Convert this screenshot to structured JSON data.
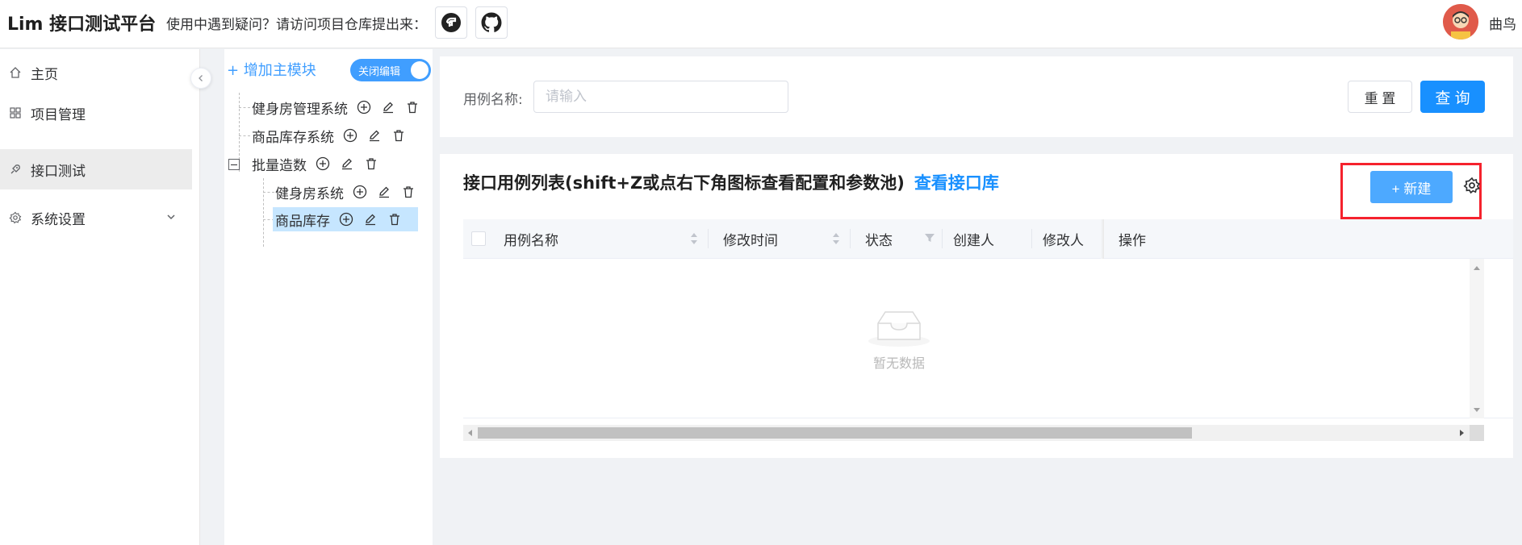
{
  "header": {
    "logo": "Lim 接口测试平台",
    "notice": "使用中遇到疑问？请访问项目仓库提出来：",
    "username": "曲鸟",
    "icons": [
      "gitee-icon",
      "github-icon"
    ]
  },
  "sidebar": {
    "items": [
      {
        "label": "主页",
        "icon": "home-icon"
      },
      {
        "label": "项目管理",
        "icon": "grid-icon"
      },
      {
        "label": "接口测试",
        "icon": "rocket-icon",
        "active": true
      },
      {
        "label": "系统设置",
        "icon": "gear-icon",
        "expandable": true
      }
    ]
  },
  "tree": {
    "add_label": "+ 增加主模块",
    "switch_label": "关闭编辑",
    "nodes": [
      {
        "label": "健身房管理系统",
        "level": 0
      },
      {
        "label": "商品库存系统",
        "level": 0
      },
      {
        "label": "批量造数",
        "level": 0,
        "expanded": true
      },
      {
        "label": "健身房系统",
        "level": 1
      },
      {
        "label": "商品库存",
        "level": 1,
        "selected": true
      }
    ]
  },
  "search": {
    "label": "用例名称:",
    "placeholder": "请输入",
    "reset_label": "重 置",
    "query_label": "查 询"
  },
  "list": {
    "title": "接口用例列表(shift+Z或点右下角图标查看配置和参数池)",
    "library_link": "查看接口库",
    "new_label": "+ 新建",
    "columns": [
      "用例名称",
      "修改时间",
      "状态",
      "创建人",
      "修改人",
      "操作"
    ],
    "empty_text": "暂无数据"
  },
  "colors": {
    "primary": "#1890ff",
    "highlight_frame": "#f5222d",
    "selected_node": "#c6e6ff"
  }
}
